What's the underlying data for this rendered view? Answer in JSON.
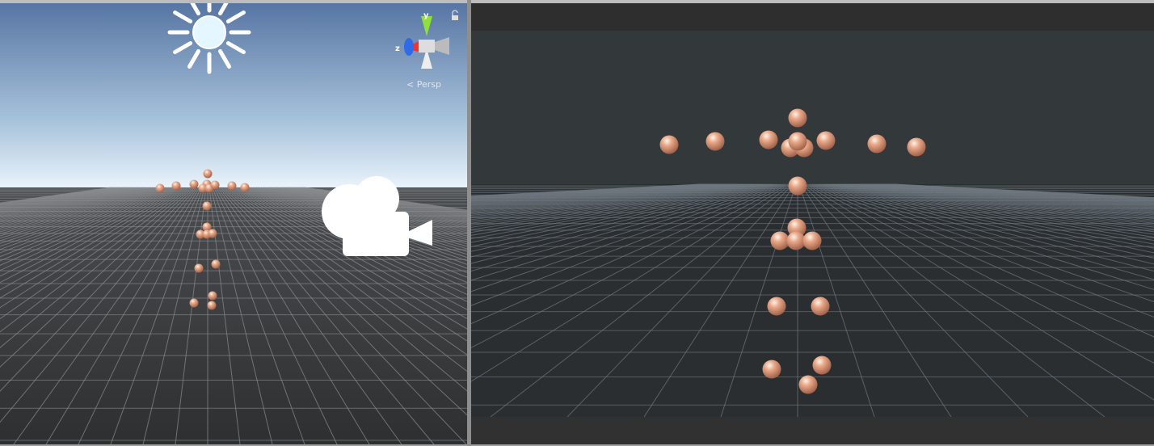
{
  "scene_view": {
    "projection_label": "Persp",
    "gizmo_axes": {
      "y": "y",
      "z": "z"
    },
    "icons": [
      "sun-icon",
      "camera-icon",
      "lock-icon",
      "scene-gizmo-icon"
    ]
  },
  "game_view": {},
  "colors": {
    "sphere": "#e8a888",
    "sky_top": "#5775a3",
    "horizon": "#e9f3fb",
    "game_sky": "#33383b",
    "ground": "#3a3c3e"
  }
}
